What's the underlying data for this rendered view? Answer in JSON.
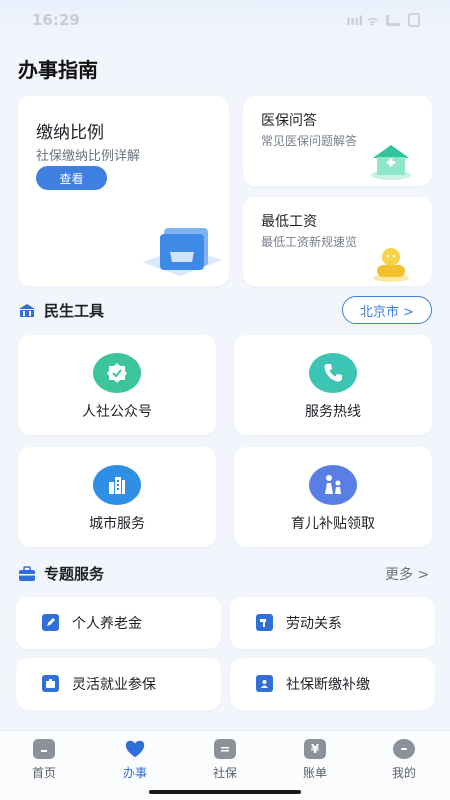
{
  "status_bar": {
    "time": "16:29",
    "network": "ıııl ᯤ"
  },
  "page_title": "办事指南",
  "cards": {
    "contribution": {
      "title": "缴纳比例",
      "subtitle": "社保缴纳比例详解",
      "button": "查看"
    },
    "medical_qa": {
      "title": "医保问答",
      "subtitle": "常见医保问题解答"
    },
    "min_wage": {
      "title": "最低工资",
      "subtitle": "最低工资新规速览"
    }
  },
  "tools": {
    "title": "民生工具",
    "city": "北京市 >",
    "items": [
      {
        "label": "人社公众号",
        "icon": "check-badge-icon",
        "color": "#3cc59a"
      },
      {
        "label": "服务热线",
        "icon": "phone-icon",
        "color": "#3cc5b4"
      },
      {
        "label": "城市服务",
        "icon": "building-icon",
        "color": "#2f8fe6"
      },
      {
        "label": "育儿补贴领取",
        "icon": "family-icon",
        "color": "#5a7fe4"
      }
    ]
  },
  "special": {
    "title": "专题服务",
    "more": "更多 >",
    "items": [
      {
        "label": "个人养老金",
        "icon": "pencil-icon"
      },
      {
        "label": "劳动关系",
        "icon": "hammer-icon"
      },
      {
        "label": "灵活就业参保",
        "icon": "briefcase-icon"
      },
      {
        "label": "社保断缴补缴",
        "icon": "shield-user-icon"
      }
    ]
  },
  "tabbar": [
    {
      "label": "首页",
      "icon": "home-icon",
      "active": false
    },
    {
      "label": "办事",
      "icon": "heart-icon",
      "active": true
    },
    {
      "label": "社保",
      "icon": "card-icon",
      "active": false
    },
    {
      "label": "账单",
      "icon": "yuan-icon",
      "active": false
    },
    {
      "label": "我的",
      "icon": "chat-user-icon",
      "active": false
    }
  ],
  "colors": {
    "accent": "#2f6fd6",
    "button": "#3f7fe0",
    "background": "#f2f5fb"
  }
}
